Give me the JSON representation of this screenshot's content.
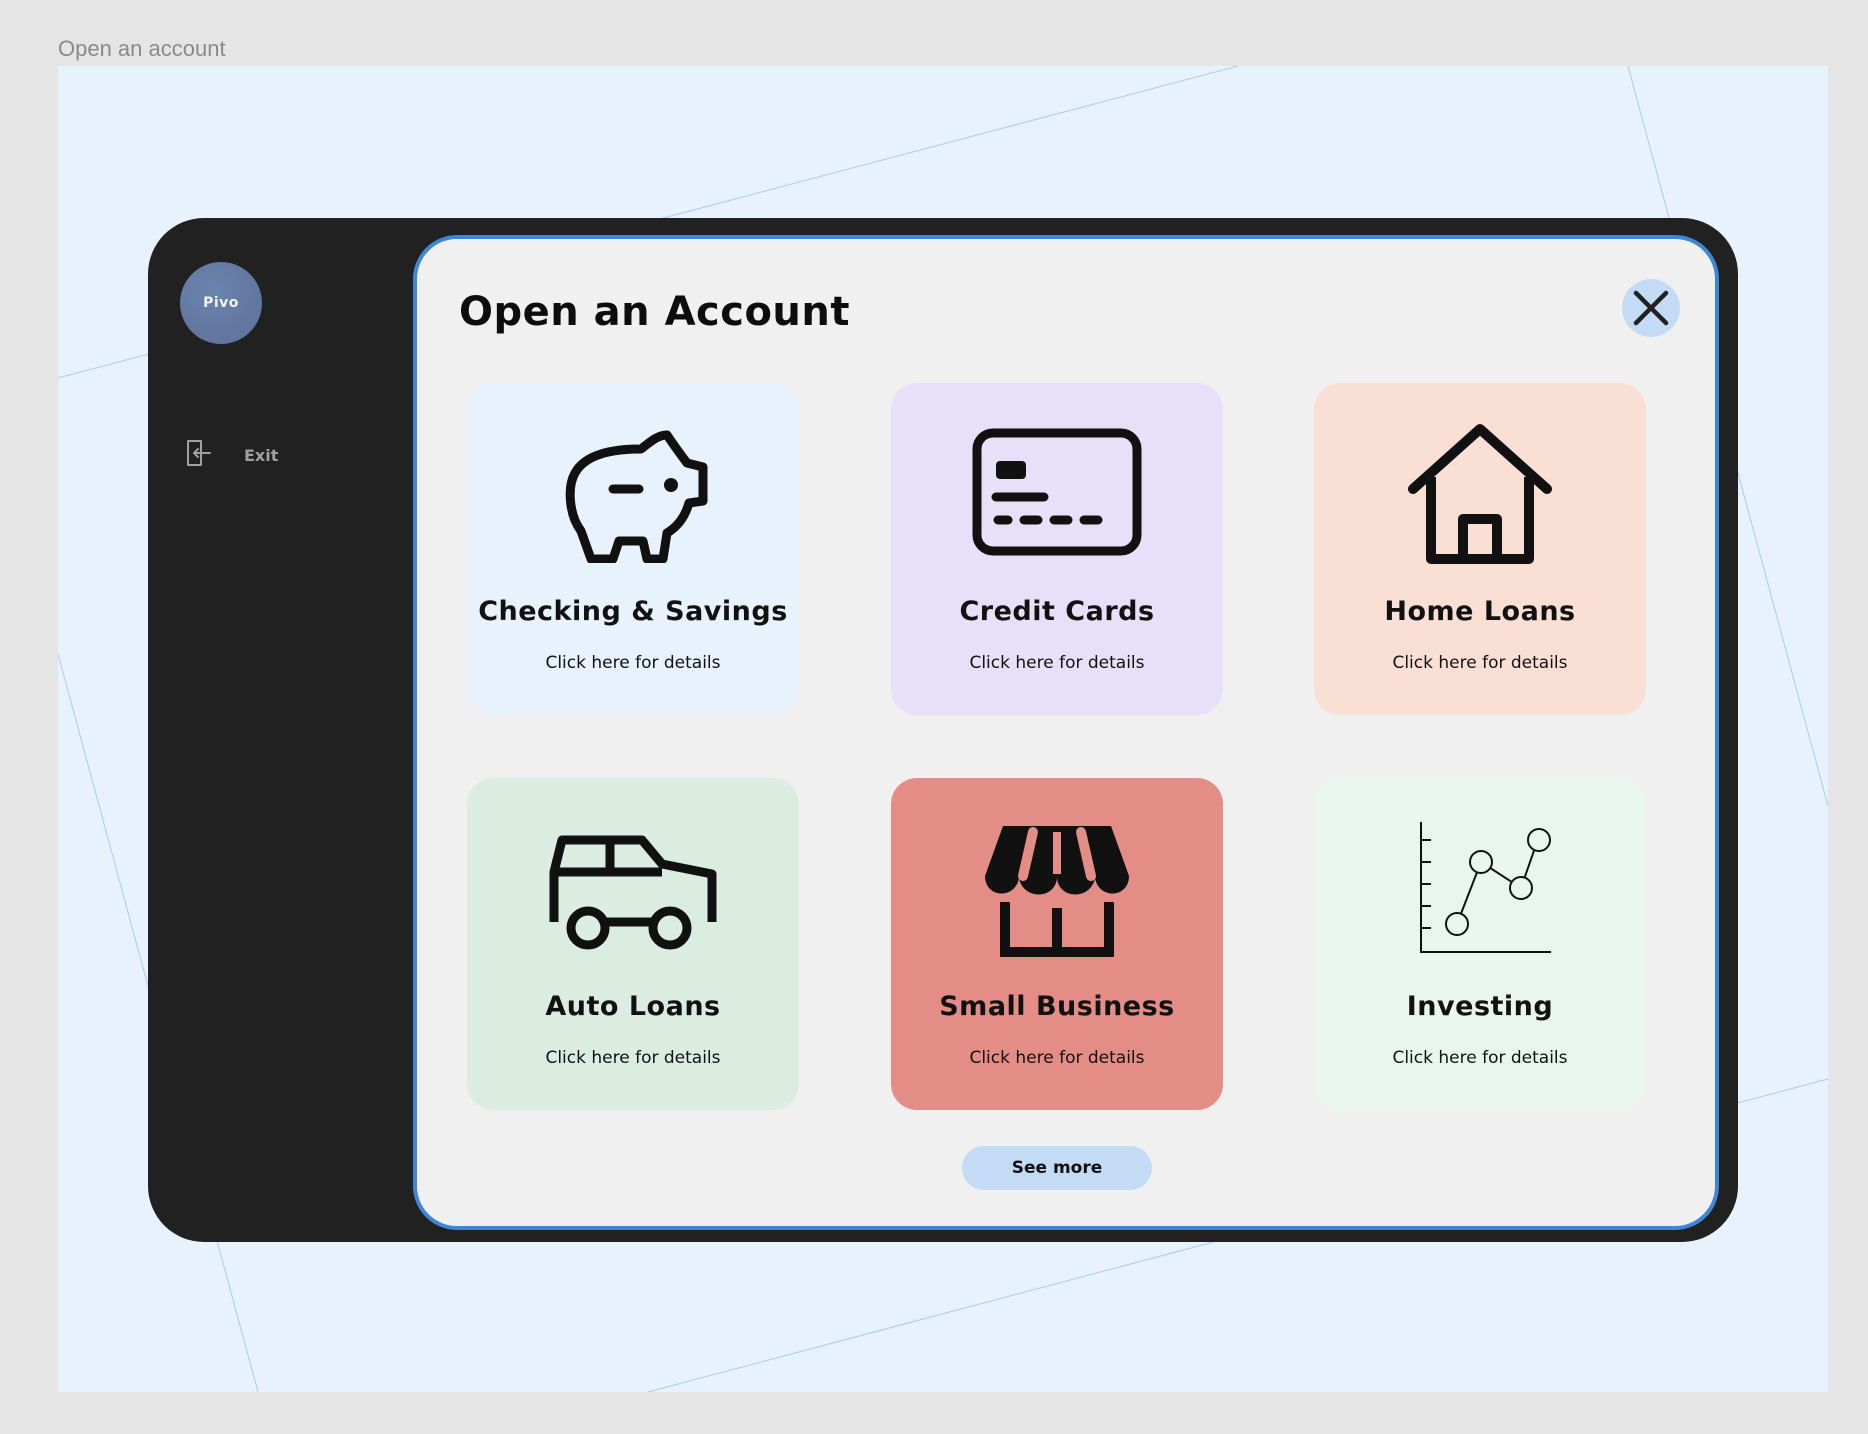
{
  "frame": {
    "label": "Open an account"
  },
  "sidebar": {
    "logo_text": "Pivo",
    "logo_color": "#6079a3",
    "exit_label": "Exit"
  },
  "modal": {
    "title": "Open an Account",
    "close_icon": "close-icon",
    "border_color": "#3f86d6",
    "cards": [
      {
        "title": "Checking & Savings",
        "subtitle": "Click here for details",
        "icon": "piggy-bank-icon",
        "bg": "#e7f2fc"
      },
      {
        "title": "Credit Cards",
        "subtitle": "Click here for details",
        "icon": "credit-card-icon",
        "bg": "#e6e0f8"
      },
      {
        "title": "Home Loans",
        "subtitle": "Click here for details",
        "icon": "house-icon",
        "bg": "#fae0d4"
      },
      {
        "title": "Auto Loans",
        "subtitle": "Click here for details",
        "icon": "car-icon",
        "bg": "#dbede0"
      },
      {
        "title": "Small Business",
        "subtitle": "Click here for details",
        "icon": "storefront-icon",
        "bg": "#e48d86"
      },
      {
        "title": "Investing",
        "subtitle": "Click here for details",
        "icon": "line-chart-icon",
        "bg": "#e8f6ee"
      }
    ],
    "see_more_label": "See more"
  }
}
